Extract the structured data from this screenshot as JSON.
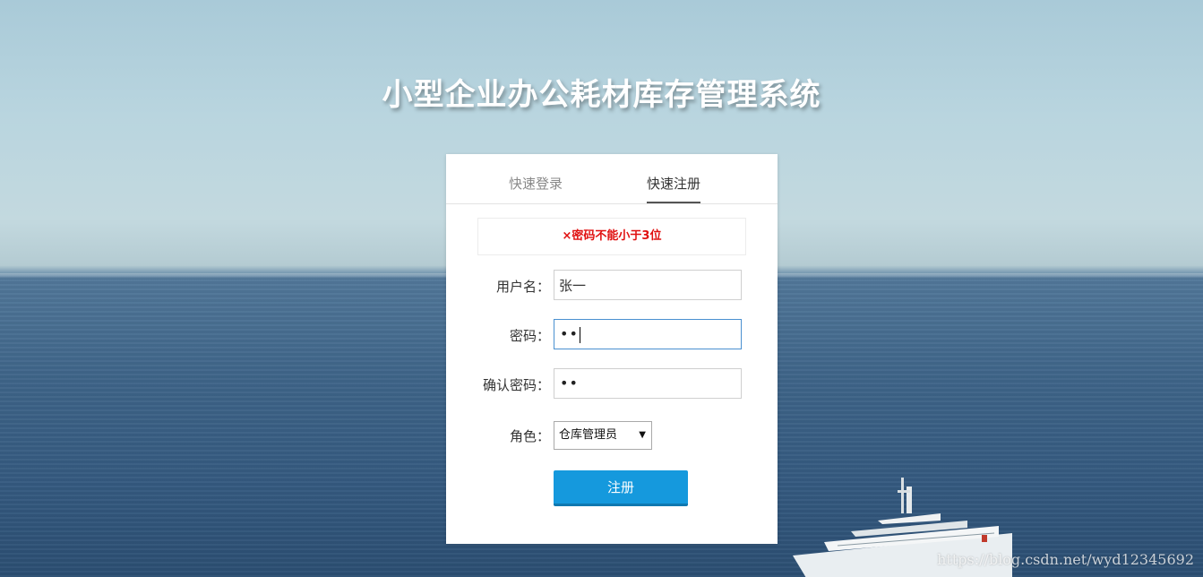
{
  "page": {
    "title": "小型企业办公耗材库存管理系统"
  },
  "tabs": [
    {
      "label": "快速登录",
      "active": false
    },
    {
      "label": "快速注册",
      "active": true
    }
  ],
  "error": {
    "message": "×密码不能小于3位",
    "color": "#e01010"
  },
  "form": {
    "username": {
      "label": "用户名：",
      "value": "张一"
    },
    "password": {
      "label": "密码：",
      "masked_value": "••"
    },
    "confirm_password": {
      "label": "确认密码：",
      "masked_value": "••"
    },
    "role": {
      "label": "角色：",
      "selected": "仓库管理员"
    },
    "submit_label": "注册"
  },
  "colors": {
    "accent": "#1599dd",
    "error": "#e01010"
  },
  "watermark": "https://blog.csdn.net/wyd12345692"
}
